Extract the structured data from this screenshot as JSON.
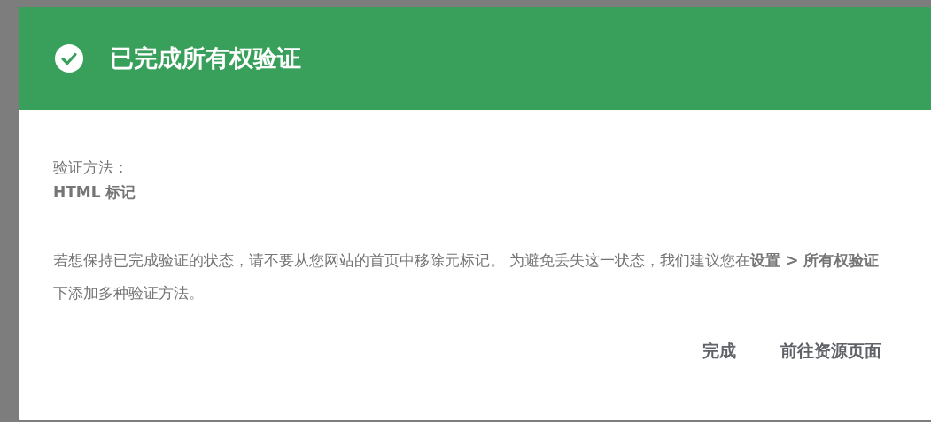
{
  "dialog": {
    "title": "已完成所有权验证",
    "method_label": "验证方法：",
    "method_value": "HTML 标记",
    "message": "若想保持已完成验证的状态，请不要从您网站的首页中移除元标记。 为避免丢失这一状态，我们建议您在**设置 > 所有权验证**下添加多种验证方法。",
    "buttons": [
      {
        "label": "完成"
      },
      {
        "label": "前往资源页面"
      }
    ]
  }
}
